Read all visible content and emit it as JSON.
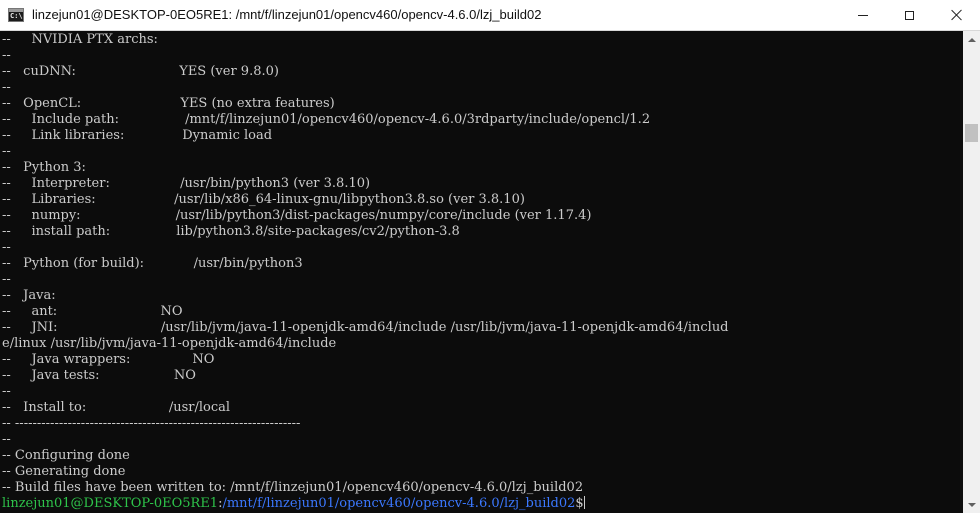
{
  "window": {
    "title": "linzejun01@DESKTOP-0EO5RE1: /mnt/f/linzejun01/opencv460/opencv-4.6.0/lzj_build02",
    "icon_text": "C:\\",
    "icons": {
      "app": "console-icon",
      "minimize": "minimize-icon",
      "maximize": "maximize-icon",
      "close": "close-icon"
    }
  },
  "terminal": {
    "lines": [
      "--     NVIDIA PTX archs:",
      "--",
      "--   cuDNN:                         YES (ver 9.8.0)",
      "--",
      "--   OpenCL:                        YES (no extra features)",
      "--     Include path:                /mnt/f/linzejun01/opencv460/opencv-4.6.0/3rdparty/include/opencl/1.2",
      "--     Link libraries:              Dynamic load",
      "--",
      "--   Python 3:",
      "--     Interpreter:                 /usr/bin/python3 (ver 3.8.10)",
      "--     Libraries:                   /usr/lib/x86_64-linux-gnu/libpython3.8.so (ver 3.8.10)",
      "--     numpy:                       /usr/lib/python3/dist-packages/numpy/core/include (ver 1.17.4)",
      "--     install path:                lib/python3.8/site-packages/cv2/python-3.8",
      "--",
      "--   Python (for build):            /usr/bin/python3",
      "--",
      "--   Java:",
      "--     ant:                         NO",
      "--     JNI:                         /usr/lib/jvm/java-11-openjdk-amd64/include /usr/lib/jvm/java-11-openjdk-amd64/includ",
      "e/linux /usr/lib/jvm/java-11-openjdk-amd64/include",
      "--     Java wrappers:               NO",
      "--     Java tests:                  NO",
      "--",
      "--   Install to:                    /usr/local",
      "-- -----------------------------------------------------------------",
      "--",
      "-- Configuring done",
      "-- Generating done",
      "-- Build files have been written to: /mnt/f/linzejun01/opencv460/opencv-4.6.0/lzj_build02"
    ],
    "prompt": {
      "user_host": "linzejun01@DESKTOP-0EO5RE1",
      "separator": ":",
      "path": "/mnt/f/linzejun01/opencv460/opencv-4.6.0/lzj_build02",
      "symbol": "$"
    }
  },
  "colors": {
    "background": "#0c0c0c",
    "text": "#cccccc",
    "prompt_user": "#2ec34a",
    "prompt_path": "#3b78ff"
  }
}
